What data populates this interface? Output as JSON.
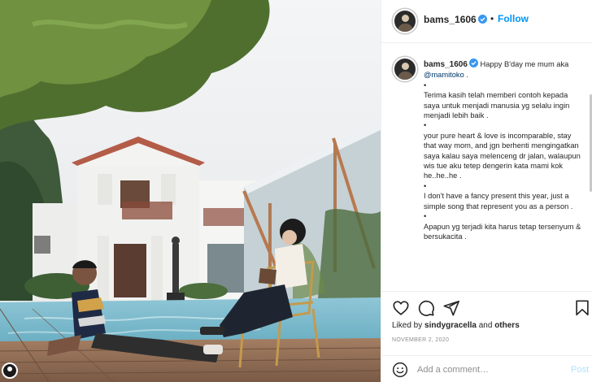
{
  "post": {
    "username": "bams_1606",
    "verified": true,
    "follow_label": "Follow",
    "separator": "•"
  },
  "caption": {
    "username": "bams_1606",
    "intro": "Happy B'day me mum aka",
    "mention": "@mamitoko",
    "intro_end": ".",
    "lines": [
      "•",
      "Terima kasih telah memberi contoh kepada saya untuk menjadi manusia yg selalu ingin menjadi lebih baik .",
      "•",
      "your pure heart & love is incomparable, stay that way mom, and jgn berhenti mengingatkan saya kalau saya melenceng dr jalan, walaupun wis tue aku tetep dengerin kata mami kok he..he..he .",
      "•",
      "I don't have a fancy present this year, just a simple song that represent you as a person .",
      "•",
      "Apapun yg terjadi kita harus tetap tersenyum & bersukacita ."
    ]
  },
  "actions": {
    "like_icon": "heart-icon",
    "comment_icon": "comment-bubble-icon",
    "share_icon": "paper-plane-icon",
    "save_icon": "bookmark-icon",
    "liked_by_prefix": "Liked by",
    "liked_by_user": "sindygracella",
    "liked_by_suffix_and": "and",
    "liked_by_others": "others",
    "date": "NOVEMBER 2, 2020"
  },
  "comment_box": {
    "emoji_icon": "smiley-icon",
    "placeholder": "Add a comment…",
    "post_label": "Post"
  },
  "colors": {
    "accent": "#0095f6",
    "verified": "#3897f0",
    "post_disabled": "#b2dffc",
    "muted": "#8e8e8e",
    "mention": "#00376b"
  }
}
